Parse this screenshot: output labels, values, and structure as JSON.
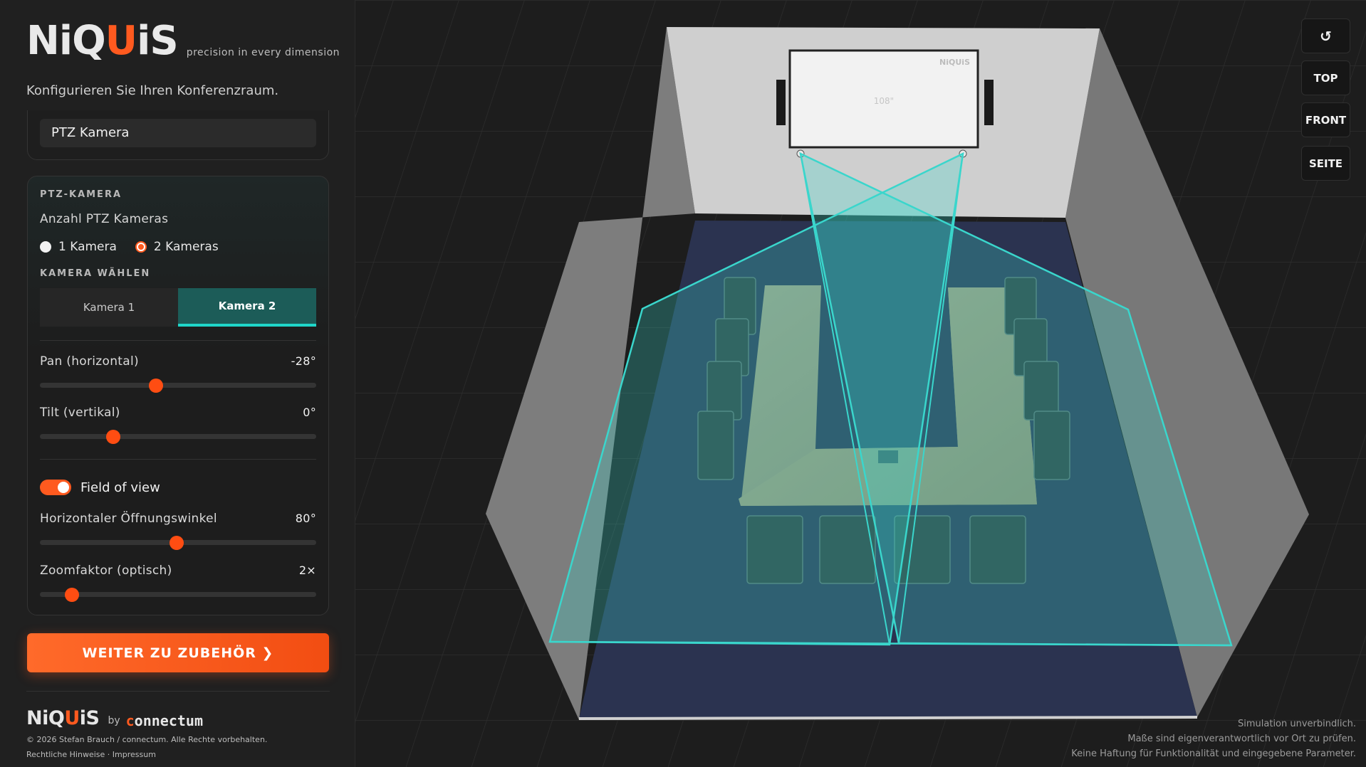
{
  "brand": {
    "logo_pre": "NiQ",
    "logo_q": "U",
    "logo_post": "iS",
    "tagline": "precision in every dimension"
  },
  "subtitle": "Konfigurieren Sie Ihren Konferenzraum.",
  "device_select": {
    "value": "PTZ Kamera"
  },
  "ptz": {
    "section_title": "PTZ-KAMERA",
    "count_label": "Anzahl PTZ Kameras",
    "options": [
      "1 Kamera",
      "2 Kameras"
    ],
    "selected_count": "2 Kameras",
    "choose_title": "KAMERA WÄHLEN",
    "tabs": [
      "Kamera 1",
      "Kamera 2"
    ],
    "active_tab": "Kamera 2",
    "pan": {
      "label": "Pan (horizontal)",
      "value": "-28°",
      "fraction": 0.42
    },
    "tilt": {
      "label": "Tilt (vertikal)",
      "value": "0°",
      "fraction": 0.265
    },
    "fov_toggle": {
      "label": "Field of view",
      "on": true
    },
    "hfov": {
      "label": "Horizontaler Öffnungswinkel",
      "value": "80°",
      "fraction": 0.495
    },
    "zoom": {
      "label": "Zoomfaktor (optisch)",
      "value": "2×",
      "fraction": 0.115
    }
  },
  "cta": {
    "label": "WEITER ZU ZUBEHÖR ❯"
  },
  "footer": {
    "by": "by",
    "partner_pre": "c",
    "partner_post": "onnectum",
    "copyright": "© 2026 Stefan Brauch / connectum. Alle Rechte vorbehalten.",
    "link_legal": "Rechtliche Hinweise",
    "link_sep": "·",
    "link_imprint": "Impressum"
  },
  "view_controls": {
    "reset_icon": "↺",
    "top": "TOP",
    "front": "FRONT",
    "side": "SEITE"
  },
  "scene": {
    "screen_size": "108\"",
    "screen_logo": "NiQUiS",
    "fov_color": "#3ad6cc",
    "accent": "#ff5a1f"
  },
  "disclaimer": {
    "line1": "Simulation unverbindlich.",
    "line2": "Maße sind eigenverantwortlich vor Ort zu prüfen.",
    "line3": "Keine Haftung für Funktionalität und eingegebene Parameter."
  }
}
